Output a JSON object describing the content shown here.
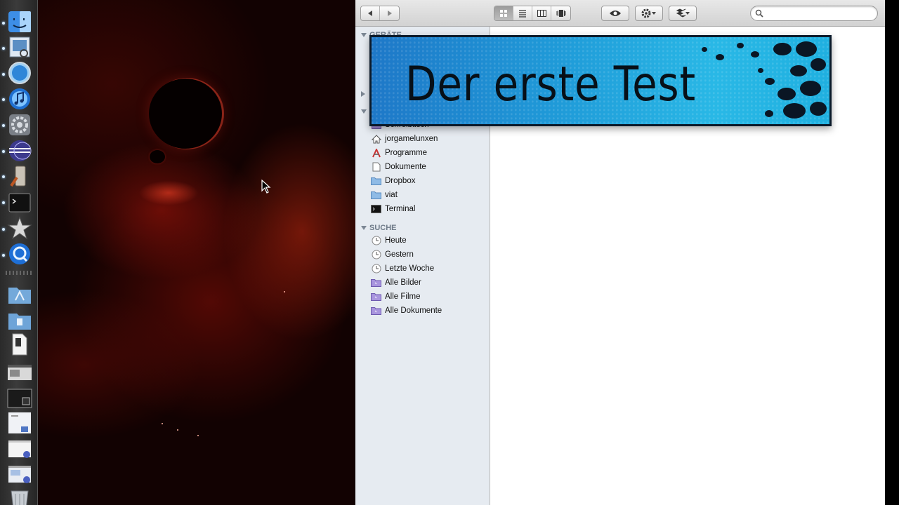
{
  "banner": {
    "title": "Der erste Test"
  },
  "toolbar": {
    "back_icon": "back-arrow-icon",
    "forward_icon": "forward-arrow-icon",
    "view_modes": [
      "icon-view",
      "list-view",
      "column-view",
      "cover-flow-view"
    ],
    "active_view": "icon-view",
    "quicklook_icon": "eye-icon",
    "action_icon": "gear-icon",
    "dropbox_icon": "dropbox-icon",
    "search": {
      "value": "",
      "placeholder": ""
    }
  },
  "sidebar": {
    "section_devices": "GERÄTE",
    "section_favorites_partial": "Schreibtisch",
    "favorites": [
      {
        "label": "jorgamelunxen",
        "icon": "home-icon"
      },
      {
        "label": "Programme",
        "icon": "applications-icon"
      },
      {
        "label": "Dokumente",
        "icon": "document-icon"
      },
      {
        "label": "Dropbox",
        "icon": "folder-icon"
      },
      {
        "label": "viat",
        "icon": "folder-icon"
      },
      {
        "label": "Terminal",
        "icon": "terminal-icon"
      }
    ],
    "search_section": "SUCHE",
    "searches": [
      {
        "label": "Heute",
        "icon": "clock-icon"
      },
      {
        "label": "Gestern",
        "icon": "clock-icon"
      },
      {
        "label": "Letzte Woche",
        "icon": "clock-icon"
      },
      {
        "label": "Alle Bilder",
        "icon": "smart-folder-icon"
      },
      {
        "label": "Alle Filme",
        "icon": "smart-folder-icon"
      },
      {
        "label": "Alle Dokumente",
        "icon": "smart-folder-icon"
      }
    ]
  },
  "dock": {
    "items": [
      "finder-icon",
      "preview-icon",
      "safari-icon",
      "itunes-icon",
      "system-preferences-icon",
      "eclipse-icon",
      "script-editor-icon",
      "terminal-icon",
      "imovie-icon",
      "quicktime-icon"
    ],
    "stacks": [
      "applications-stack-icon",
      "documents-stack-icon",
      "file-icon",
      "screenshot-thumb-icon",
      "window-thumb-icon",
      "image-thumb-icon",
      "window-thumb-icon",
      "window-thumb-icon",
      "trash-icon"
    ]
  },
  "colors": {
    "banner": "#1f9ad8",
    "sidebar": "#e6ebf1",
    "wallpaper": "#8a140a"
  }
}
